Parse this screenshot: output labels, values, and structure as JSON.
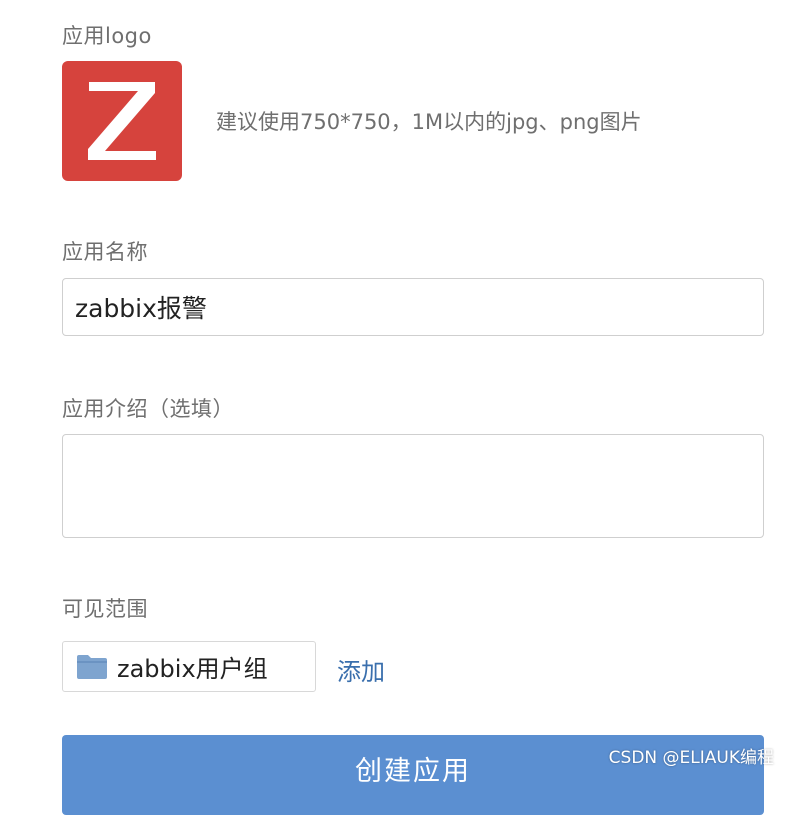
{
  "logo_section": {
    "label": "应用logo",
    "logo_letter": "Z",
    "logo_color": "#d6433d",
    "hint": "建议使用750*750，1M以内的jpg、png图片"
  },
  "name_section": {
    "label": "应用名称",
    "value": "zabbix报警"
  },
  "intro_section": {
    "label": "应用介绍（选填）",
    "value": ""
  },
  "scope_section": {
    "label": "可见范围",
    "chip_icon": "folder-icon",
    "chip_label": "zabbix用户组",
    "add_link": "添加"
  },
  "create_button": {
    "label": "创建应用",
    "color": "#5b8fd1"
  },
  "watermark": "CSDN @ELIAUK编程"
}
